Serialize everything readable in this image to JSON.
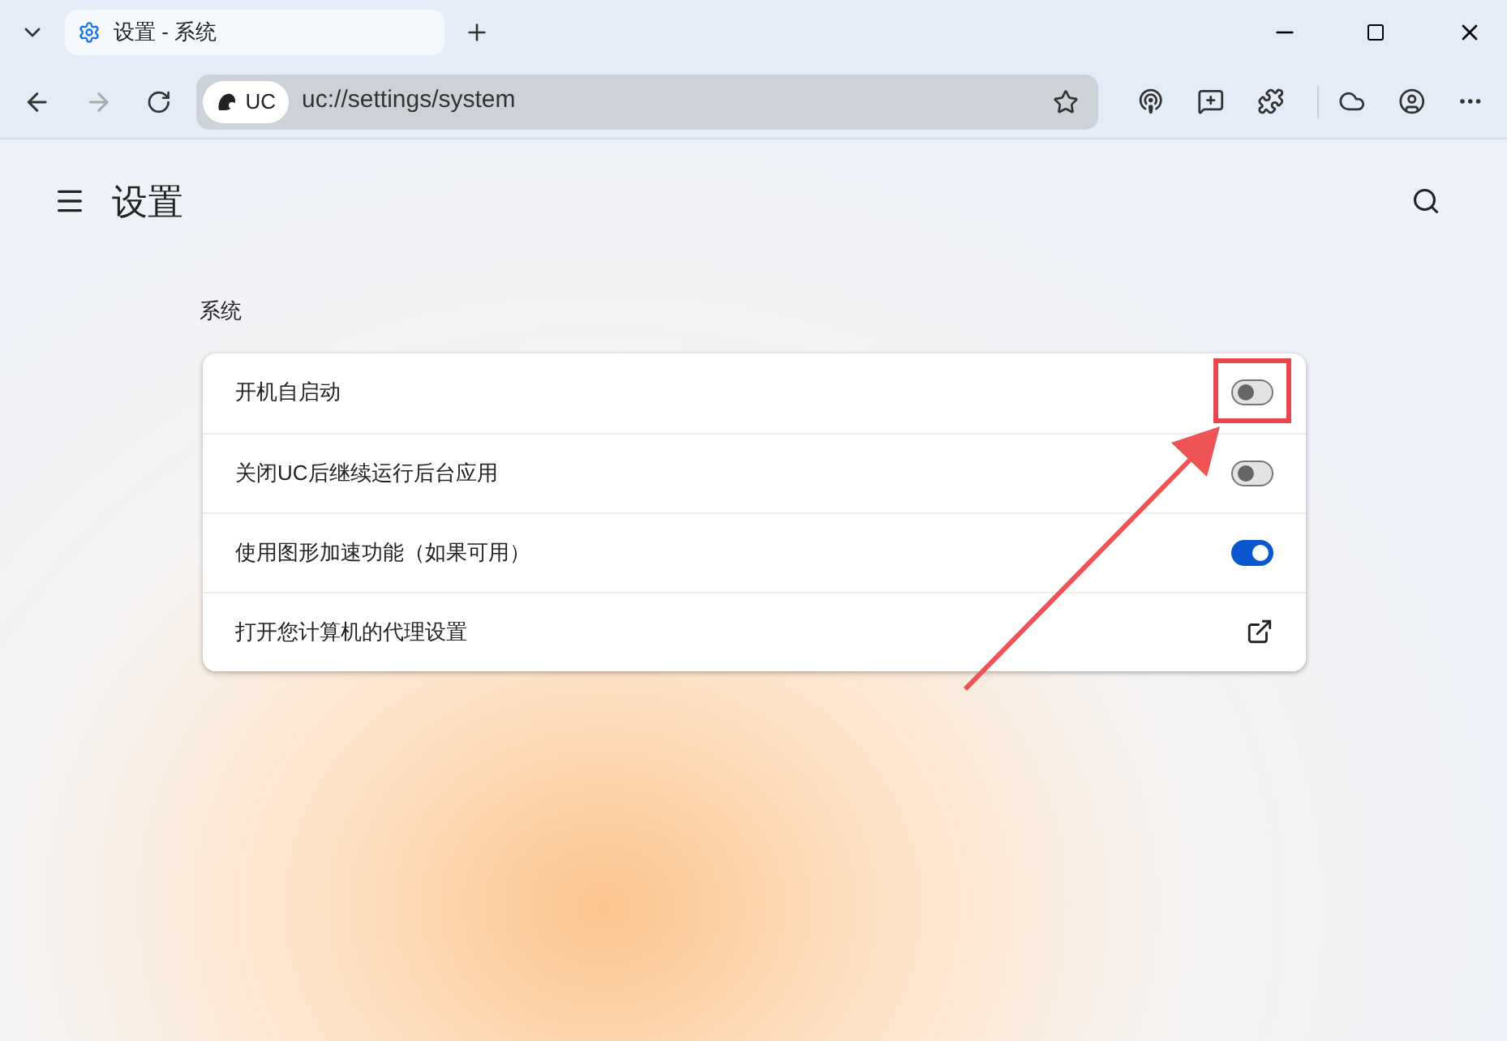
{
  "tab": {
    "title": "设置 - 系统",
    "selected": true
  },
  "address_bar": {
    "badge": "UC",
    "url": "uc://settings/system"
  },
  "page": {
    "title": "设置",
    "section": "系统"
  },
  "rows": [
    {
      "kind": "toggle",
      "label": "开机自启动",
      "on": false,
      "highlighted": true
    },
    {
      "kind": "toggle",
      "label": "关闭UC后继续运行后台应用",
      "on": false,
      "highlighted": false
    },
    {
      "kind": "toggle",
      "label": "使用图形加速功能（如果可用）",
      "on": true,
      "highlighted": false
    },
    {
      "kind": "link",
      "label": "打开您计算机的代理设置"
    }
  ]
}
